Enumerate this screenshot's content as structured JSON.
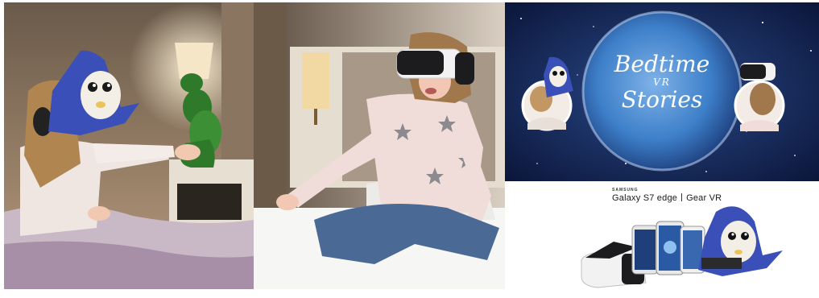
{
  "panels": {
    "bedtime_banner": {
      "title_line1": "Bedtime",
      "title_line2": "VR",
      "title_line3": "Stories"
    },
    "product_ad": {
      "brand": "SAMSUNG",
      "device": "Galaxy S7 edge",
      "accessory": "Gear VR"
    }
  },
  "colors": {
    "space_bg": "#12214f",
    "earth_glow": "#3d7fc9",
    "penguin_blue": "#3a4fb8",
    "headset_white": "#f2f2f2",
    "sweater_pink": "#f0dcd8",
    "jeans_blue": "#4a6a95"
  }
}
